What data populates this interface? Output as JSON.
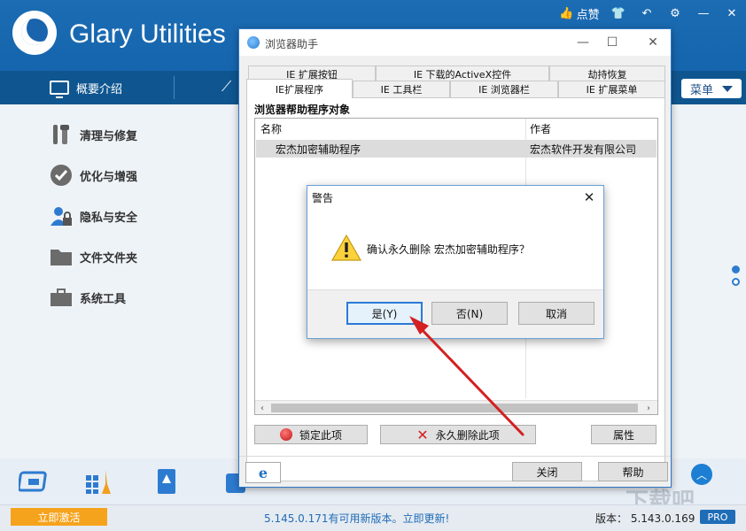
{
  "app": {
    "title": "Glary Utilities",
    "like_label": "点赞",
    "nav_overview": "概要介绍",
    "menu_label": "菜单"
  },
  "sidebar": {
    "items": [
      {
        "label": "清理与修复",
        "icon": "wrench-icon"
      },
      {
        "label": "优化与增强",
        "icon": "check-circle-icon"
      },
      {
        "label": "隐私与安全",
        "icon": "user-lock-icon"
      },
      {
        "label": "文件文件夹",
        "icon": "folder-icon"
      },
      {
        "label": "系统工具",
        "icon": "toolbox-icon"
      }
    ]
  },
  "status": {
    "activate_label": "立即激活",
    "update_text": "5.145.0.171有可用新版本。立即更新!",
    "version_text": "版本：  5.143.0.169",
    "pro_label": "PRO"
  },
  "browser_window": {
    "title": "浏览器助手",
    "tabs_row1": [
      "IE 扩展按钮",
      "IE 下载的ActiveX控件",
      "劫持恢复"
    ],
    "tabs_row2": [
      "IE扩展程序",
      "IE 工具栏",
      "IE 浏览器栏",
      "IE 扩展菜单"
    ],
    "section_title": "浏览器帮助程序对象",
    "columns": [
      "名称",
      "作者"
    ],
    "rows": [
      {
        "name": "宏杰加密辅助程序",
        "author": "宏杰软件开发有限公司"
      }
    ],
    "lock_button": "锁定此项",
    "delete_button": "永久删除此项",
    "properties_button": "属性",
    "close_button": "关闭",
    "help_button": "帮助",
    "ie_tab_glyph": "e"
  },
  "alert": {
    "title": "警告",
    "message": "确认永久删除 宏杰加密辅助程序？",
    "yes_button": "是(Y)",
    "no_button": "否(N)",
    "cancel_button": "取消"
  },
  "watermark": "下载吧",
  "colors": {
    "header_blue": "#1565ae",
    "nav_blue": "#0f5690",
    "activate_orange": "#f5a31d",
    "arrow_red": "#d42020"
  }
}
